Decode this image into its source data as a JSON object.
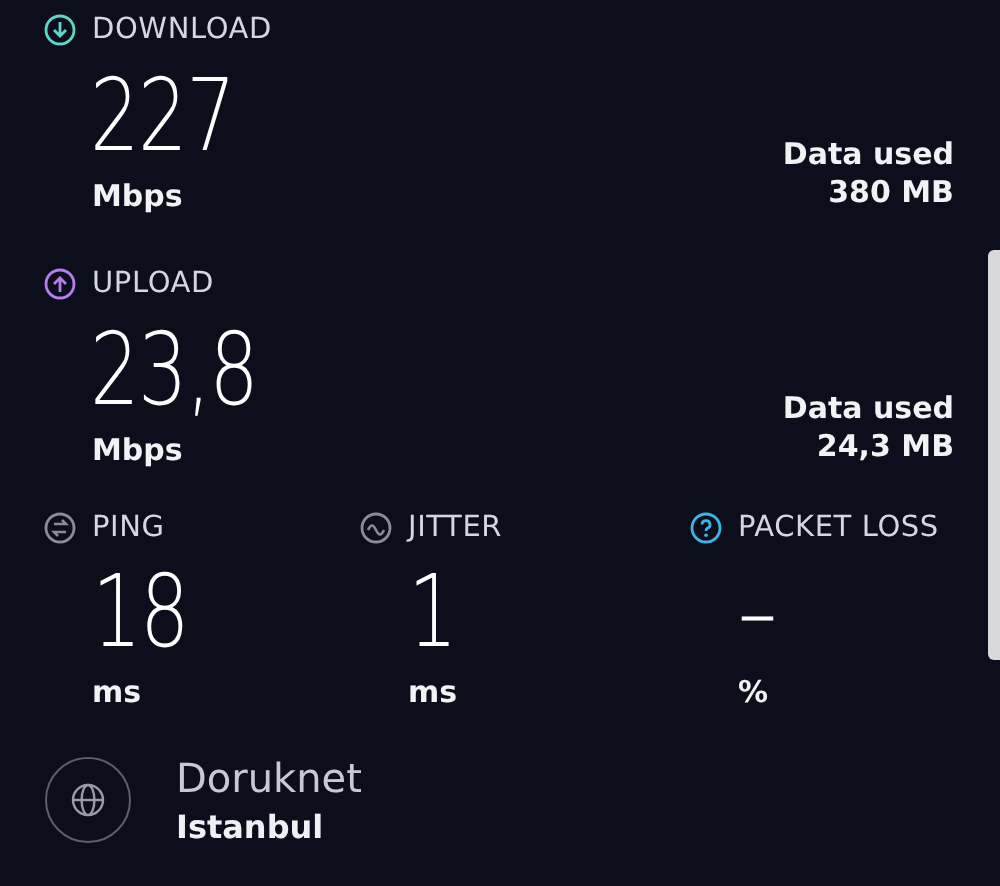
{
  "speeds": [
    {
      "kind": "download",
      "color": "#5fd6c8",
      "label": "DOWNLOAD",
      "value": "227",
      "unit": "Mbps",
      "data_label": "Data used",
      "data_value": "380 MB"
    },
    {
      "kind": "upload",
      "color": "#b57ef0",
      "label": "UPLOAD",
      "value": "23,8",
      "unit": "Mbps",
      "data_label": "Data used",
      "data_value": "24,3 MB"
    }
  ],
  "metrics": [
    {
      "kind": "ping",
      "color": "#8a8c99",
      "label": "PING",
      "value": "18",
      "unit": "ms"
    },
    {
      "kind": "jitter",
      "color": "#8a8c99",
      "label": "JITTER",
      "value": "1",
      "unit": "ms"
    },
    {
      "kind": "loss",
      "color": "#3cb5e8",
      "label": "PACKET LOSS",
      "value": "–",
      "unit": "%"
    }
  ],
  "server": {
    "name": "Doruknet",
    "location": "Istanbul"
  }
}
